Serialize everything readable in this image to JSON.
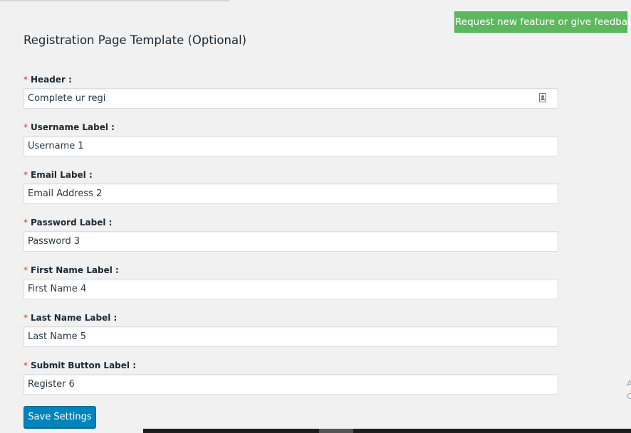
{
  "feedback_button": {
    "label": "Request new feature or give feedback",
    "color": "#5cb85c"
  },
  "page": {
    "title": "Registration Page Template (Optional)"
  },
  "required_marker": "*",
  "fields": [
    {
      "label": "Header :",
      "value": "Complete ur regi"
    },
    {
      "label": "Username Label :",
      "value": "Username 1"
    },
    {
      "label": "Email Label :",
      "value": "Email Address 2"
    },
    {
      "label": "Password Label :",
      "value": "Password 3"
    },
    {
      "label": "First Name Label :",
      "value": "First Name 4"
    },
    {
      "label": "Last Name Label :",
      "value": "Last Name 5"
    },
    {
      "label": "Submit Button Label :",
      "value": "Register 6"
    }
  ],
  "header_field_icon": "contact-card-icon",
  "save_button": {
    "label": "Save Settings",
    "color": "#0085ba"
  },
  "edge_glyphs": {
    "top": "A",
    "bottom": "C"
  }
}
